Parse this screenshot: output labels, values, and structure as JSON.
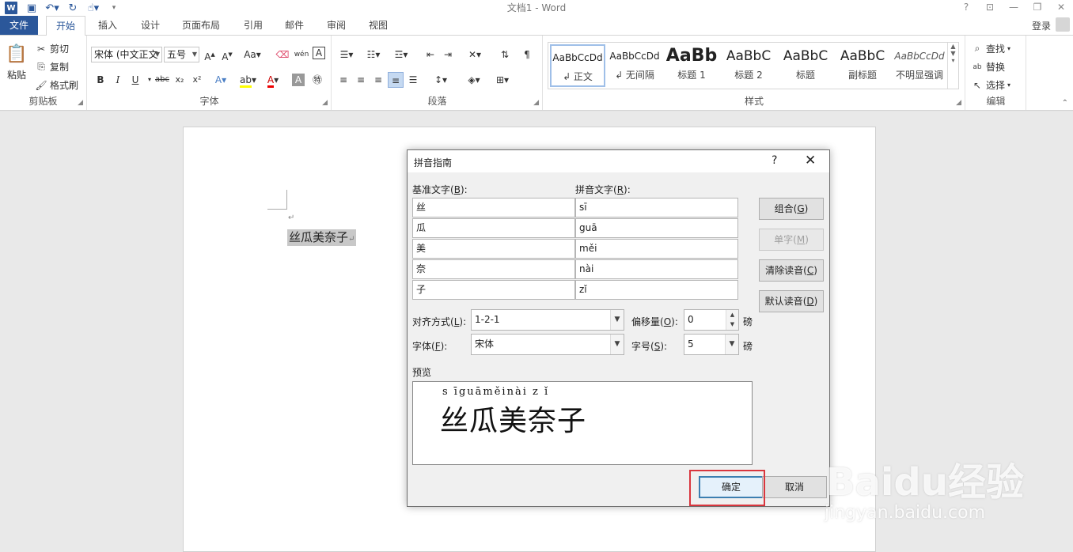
{
  "app": {
    "title": "文档1 - Word",
    "login_label": "登录"
  },
  "tabs": [
    "文件",
    "开始",
    "插入",
    "设计",
    "页面布局",
    "引用",
    "邮件",
    "审阅",
    "视图"
  ],
  "ribbon": {
    "clipboard": {
      "paste": "粘贴",
      "cut": "剪切",
      "copy": "复制",
      "format_painter": "格式刷",
      "label": "剪贴板"
    },
    "font": {
      "font_name": "宋体 (中文正文",
      "font_size": "五号",
      "label": "字体"
    },
    "paragraph": {
      "label": "段落"
    },
    "styles": {
      "label": "样式",
      "items": [
        {
          "sample": "AaBbCcDd",
          "name": "↲ 正文"
        },
        {
          "sample": "AaBbCcDd",
          "name": "↲ 无间隔"
        },
        {
          "sample": "AaBb",
          "name": "标题 1"
        },
        {
          "sample": "AaBbC",
          "name": "标题 2"
        },
        {
          "sample": "AaBbC",
          "name": "标题"
        },
        {
          "sample": "AaBbC",
          "name": "副标题"
        },
        {
          "sample": "AaBbCcDd",
          "name": "不明显强调"
        }
      ]
    },
    "editing": {
      "find": "查找",
      "replace": "替换",
      "select": "选择",
      "label": "编辑"
    }
  },
  "document": {
    "selected_text": "丝瓜美奈子"
  },
  "dialog": {
    "title": "拼音指南",
    "base_header": "基准文字",
    "base_hotkey": "B",
    "ruby_header": "拼音文字",
    "ruby_hotkey": "R",
    "rows": [
      {
        "base": "丝",
        "ruby": "sī"
      },
      {
        "base": "瓜",
        "ruby": "guā"
      },
      {
        "base": "美",
        "ruby": "měi"
      },
      {
        "base": "奈",
        "ruby": "nài"
      },
      {
        "base": "子",
        "ruby": "zǐ"
      }
    ],
    "buttons": {
      "group": "组合",
      "group_key": "G",
      "mono": "单字",
      "mono_key": "M",
      "clear": "清除读音",
      "clear_key": "C",
      "default": "默认读音",
      "default_key": "D",
      "ok": "确定",
      "cancel": "取消"
    },
    "alignment_label": "对齐方式",
    "alignment_key": "L",
    "alignment_value": "1-2-1",
    "offset_label": "偏移量",
    "offset_key": "O",
    "offset_value": "0",
    "offset_unit": "磅",
    "font_label": "字体",
    "font_key": "F",
    "font_value": "宋体",
    "size_label": "字号",
    "size_key": "S",
    "size_value": "5",
    "size_unit": "磅",
    "preview_label": "预览",
    "preview_pinyin": "s īguāměinài z ǐ",
    "preview_base": "丝瓜美奈子"
  },
  "watermark": {
    "brand": "Baidu经验",
    "url": "jingyan.baidu.com"
  }
}
